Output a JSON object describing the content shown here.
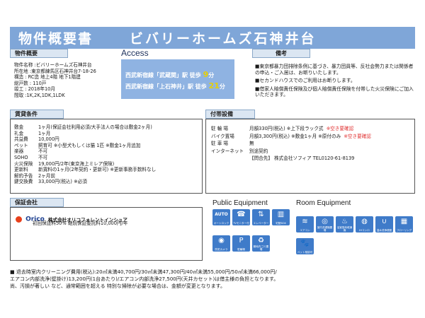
{
  "banner": {
    "doc_title": "物件概要書",
    "property_name": "ビバリーホームズ石神井台"
  },
  "overview": {
    "label": "物件概要",
    "lines": [
      "物件名称 :ビバリーホームズ石神井台",
      "所在地 :東京都練馬区石神井台7-18-26",
      "構造 : RC造 地上4階 地下1階建",
      "総戸数 : 110戸",
      "竣工 : 2018年10月",
      "間取 :1K,2K,1DK,1LDK"
    ]
  },
  "access": {
    "title": "Access",
    "routes": [
      {
        "line": "西武新宿線「武蔵関」駅",
        "walk": "徒歩",
        "minutes": "9",
        "unit": "分"
      },
      {
        "line": "西武新宿線「上石神井」駅",
        "walk": "徒歩",
        "minutes": "21",
        "unit": "分"
      }
    ]
  },
  "remarks": {
    "label": "備考",
    "items": [
      "■東京都暴力団排除条例に基づき、暴力団員等、反社会勢力または関係者の申込・ご入居は、お断りいたします。",
      "■セカンドハウスでのご利用はお断りします。",
      "■借家人賠償責任保険及び個人賠償責任保険を付帯した火災保険にご加入いただきます。"
    ]
  },
  "conditions": {
    "label": "賃貸条件",
    "rows": [
      {
        "k": "敷金",
        "v": "1ヶ月(保証会社利用必須/大手法人の場合は敷金2ヶ月)"
      },
      {
        "k": "礼金",
        "v": "1ヶ月"
      },
      {
        "k": "共益費",
        "v": "10,000円"
      },
      {
        "k": "ペット",
        "v": "飼育可 ※小型犬もしくは猫 1匹 ※敷金1ヶ月追加"
      },
      {
        "k": "楽器",
        "v": "不可"
      },
      {
        "k": "SOHO",
        "v": "不可"
      },
      {
        "k": "火災保険",
        "v": "19,000円/2年(東京海上ミレア保険)"
      },
      {
        "k": "更新料",
        "v": "新賃料の1ヶ月(2年契約・更新可)  ※更新事務手数料なし"
      },
      {
        "k": "解約予告",
        "v": "2ヶ月前"
      },
      {
        "k": "鍵交換費",
        "v": "33,000円(税込)  ※必須"
      }
    ]
  },
  "facilities": {
    "label": "付帯設備",
    "rows": [
      {
        "k": "駐 輪 場",
        "v": "月額330円(税込)  ※上下段ラック式",
        "note": "※空き要確認"
      },
      {
        "k": "バイク置場",
        "v": "月額3,300円(税込)  ※敷金1ヶ月  ※原付のみ",
        "note": "※空き要確認"
      },
      {
        "k": "駐 車 場",
        "v": "無",
        "note": ""
      },
      {
        "k": "インターネット",
        "v": "別途契約",
        "note": ""
      },
      {
        "k": "",
        "v": "【問合先】 株式会社ソフィア TEL0120-61-8139",
        "note": ""
      }
    ]
  },
  "guarantor": {
    "label": "保証会社",
    "logo_text": "Orico",
    "company": "株式会社オリコフォレントインシュア",
    "note": "初回保証料50%  継続保証委託料10,000円/年"
  },
  "equipment": {
    "public_title": "Public Equipment",
    "room_title": "Room Equipment",
    "public_icons": [
      {
        "name": "auto-lock-icon",
        "glyph": "AUTO",
        "caption": "オートロック"
      },
      {
        "name": "tv-intercom-icon",
        "glyph": "☎",
        "caption": "TVモニター付"
      },
      {
        "name": "elevator-icon",
        "glyph": "⇅",
        "caption": "エレベーター"
      },
      {
        "name": "delivery-box-icon",
        "glyph": "▥",
        "caption": "宅配BOX"
      },
      {
        "name": "security-camera-icon",
        "glyph": "◉",
        "caption": "防犯カメラ"
      },
      {
        "name": "bicycle-parking-icon",
        "glyph": "P",
        "caption": "駐輪場"
      },
      {
        "name": "garbage-station-icon",
        "glyph": "♻",
        "caption": "敷地内ゴミ置場"
      }
    ],
    "room_icons": [
      {
        "name": "air-conditioner-icon",
        "glyph": "≋",
        "caption": "エアコン"
      },
      {
        "name": "washing-space-icon",
        "glyph": "◎",
        "caption": "室内洗濯機置場"
      },
      {
        "name": "bathroom-dryer-icon",
        "glyph": "♨",
        "caption": "浴室換気乾燥機"
      },
      {
        "name": "ih-stove-icon",
        "glyph": "◍",
        "caption": "IHコンロ"
      },
      {
        "name": "washlet-icon",
        "glyph": "∪",
        "caption": "温水洗浄便座"
      },
      {
        "name": "flooring-icon",
        "glyph": "▦",
        "caption": "フローリング"
      },
      {
        "name": "pet-allowed-icon",
        "glyph": "🐾",
        "caption": "ペット相談可"
      }
    ]
  },
  "footer": {
    "lines": [
      "■ 退去時室内クリーニング費用(税込):20㎡未満40,700円/30㎡未満47,300円/40㎡未満55,000円/50㎡未満66,000円/",
      "エアコン内部洗浄(壁掛け)13,200円(1台あたり)/エアコン内部洗浄27,500円(天井カセット)は借主様の負担となります。",
      "尚、汚損が著しい など、通常範囲を超える 特別な掃除が必要な場合は、金額が変更となります。"
    ]
  }
}
